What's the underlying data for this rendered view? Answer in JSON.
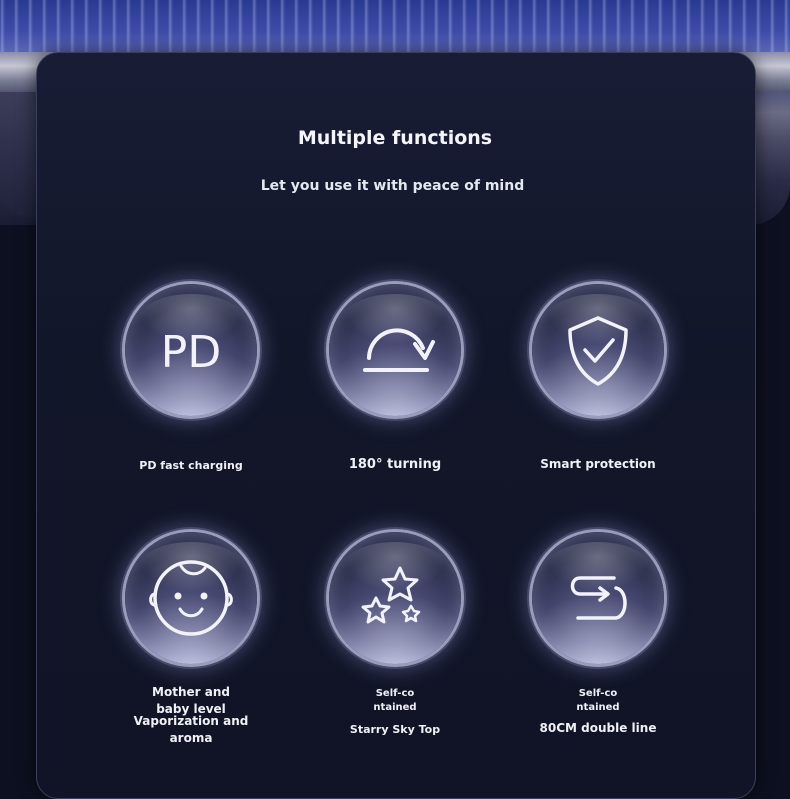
{
  "header": {
    "title": "Multiple functions",
    "subtitle": "Let you use it with peace of mind"
  },
  "features": [
    {
      "icon": "pd-icon",
      "icon_text": "PD",
      "label": "PD fast charging"
    },
    {
      "icon": "rotate-arrow-icon",
      "label": "180° turning"
    },
    {
      "icon": "shield-check-icon",
      "label": "Smart protection"
    },
    {
      "icon": "baby-face-icon",
      "label_lines": [
        "Mother and",
        "baby level",
        "Vaporization and",
        "aroma"
      ]
    },
    {
      "icon": "stars-icon",
      "label_lines": [
        "Self-co",
        "ntained",
        "Starry Sky Top"
      ]
    },
    {
      "icon": "double-line-icon",
      "label_lines": [
        "Self-co",
        "ntained",
        "80CM double line"
      ]
    }
  ],
  "colors": {
    "background": "#0d1020",
    "card": "#141830",
    "text": "#f0f1f7",
    "icon_stroke": "#f2f3fa"
  }
}
